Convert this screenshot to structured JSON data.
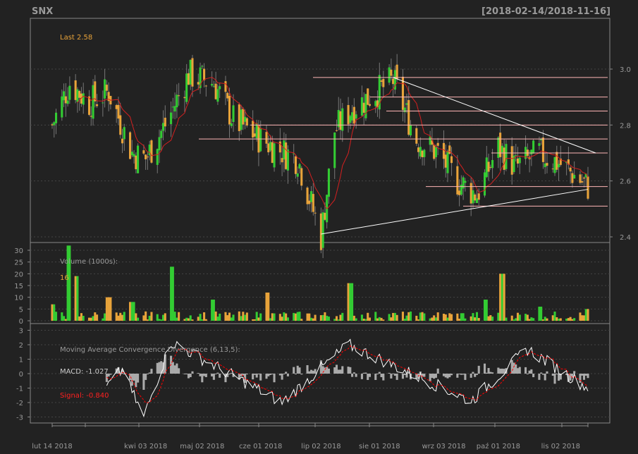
{
  "title": {
    "symbol": "SNX",
    "range": "[2018-02-14/2018-11-16]"
  },
  "colors": {
    "bg": "#222222",
    "frame": "#888888",
    "grid": "#444444",
    "up": "#33cc33",
    "down": "#e8a33a",
    "ma": "#d42020",
    "line": "#ffffff",
    "res": "#ffb6b6",
    "text": "#999999",
    "last": "#e8a33a",
    "macd": "#ffffff",
    "signal": "#ff0000",
    "hist": "#aaaaaa"
  },
  "price_panel": {
    "last_label": "Last 2.58",
    "yticks": [
      "2.4",
      "2.6",
      "2.8",
      "3.0"
    ]
  },
  "volume_panel": {
    "label": "Volume (1000s):",
    "value": "16",
    "yticks": [
      "0",
      "5",
      "10",
      "15",
      "20",
      "25",
      "30"
    ]
  },
  "macd_panel": {
    "label": "Moving Average Convergence Divergence (6,13,5):",
    "macd_text": "MACD: -1.027",
    "signal_text": "Signal: -0.840",
    "yticks": [
      "-3",
      "-2",
      "-1",
      "0",
      "1",
      "2",
      "3"
    ]
  },
  "x_labels": [
    "lut 14 2018",
    "kwi 03 2018",
    "maj 02 2018",
    "cze 01 2018",
    "lip 02 2018",
    "sie 01 2018",
    "wrz 03 2018",
    "paź 01 2018",
    "lis 02 2018"
  ],
  "chart_data": [
    {
      "type": "candlestick",
      "title": "SNX",
      "subtitle": "[2018-02-14/2018-11-16]",
      "ylim": [
        2.38,
        3.07
      ],
      "series": [
        {
          "name": "price_anchors",
          "points": [
            {
              "x": "2018-02-14",
              "y": 2.8
            },
            {
              "x": "2018-02-23",
              "y": 2.95
            },
            {
              "x": "2018-03-05",
              "y": 2.88
            },
            {
              "x": "2018-03-15",
              "y": 2.92
            },
            {
              "x": "2018-03-27",
              "y": 2.7
            },
            {
              "x": "2018-04-03",
              "y": 2.68
            },
            {
              "x": "2018-04-13",
              "y": 2.8
            },
            {
              "x": "2018-04-25",
              "y": 2.98
            },
            {
              "x": "2018-05-08",
              "y": 2.95
            },
            {
              "x": "2018-05-18",
              "y": 2.82
            },
            {
              "x": "2018-05-30",
              "y": 2.76
            },
            {
              "x": "2018-06-08",
              "y": 2.72
            },
            {
              "x": "2018-06-20",
              "y": 2.68
            },
            {
              "x": "2018-07-02",
              "y": 2.4
            },
            {
              "x": "2018-07-09",
              "y": 2.78
            },
            {
              "x": "2018-07-18",
              "y": 2.86
            },
            {
              "x": "2018-07-31",
              "y": 2.92
            },
            {
              "x": "2018-08-08",
              "y": 2.96
            },
            {
              "x": "2018-08-20",
              "y": 2.75
            },
            {
              "x": "2018-08-31",
              "y": 2.7
            },
            {
              "x": "2018-09-10",
              "y": 2.6
            },
            {
              "x": "2018-09-20",
              "y": 2.55
            },
            {
              "x": "2018-10-01",
              "y": 2.72
            },
            {
              "x": "2018-10-10",
              "y": 2.65
            },
            {
              "x": "2018-10-22",
              "y": 2.7
            },
            {
              "x": "2018-11-02",
              "y": 2.66
            },
            {
              "x": "2018-11-16",
              "y": 2.58
            }
          ]
        },
        {
          "name": "resistance_levels",
          "values": [
            2.97,
            2.9,
            2.85,
            2.8,
            2.75,
            2.7,
            2.58,
            2.51
          ]
        }
      ],
      "trendlines": [
        {
          "from": {
            "x": "2018-07-02",
            "y": 2.41
          },
          "to": {
            "x": "2018-11-16",
            "y": 2.57
          }
        },
        {
          "from": {
            "x": "2018-08-08",
            "y": 2.97
          },
          "to": {
            "x": "2018-11-20",
            "y": 2.7
          }
        }
      ]
    },
    {
      "type": "bar",
      "title": "Volume (1000s):",
      "ylim": [
        0,
        33
      ],
      "series": [
        {
          "name": "volume",
          "points": [
            {
              "x": "2018-02-14",
              "y": 7
            },
            {
              "x": "2018-02-23",
              "y": 32
            },
            {
              "x": "2018-02-26",
              "y": 19
            },
            {
              "x": "2018-03-15",
              "y": 10
            },
            {
              "x": "2018-03-27",
              "y": 8
            },
            {
              "x": "2018-04-16",
              "y": 23
            },
            {
              "x": "2018-05-07",
              "y": 9
            },
            {
              "x": "2018-06-04",
              "y": 12
            },
            {
              "x": "2018-07-17",
              "y": 16
            },
            {
              "x": "2018-09-24",
              "y": 9
            },
            {
              "x": "2018-10-03",
              "y": 20
            },
            {
              "x": "2018-10-22",
              "y": 6
            },
            {
              "x": "2018-11-16",
              "y": 5
            }
          ]
        }
      ]
    },
    {
      "type": "line",
      "title": "Moving Average Convergence Divergence (6,13,5):",
      "ylim": [
        -3.3,
        3.3
      ],
      "series": [
        {
          "name": "MACD",
          "points": [
            {
              "x": "2018-03-26",
              "y": -1.0
            },
            {
              "x": "2018-04-02",
              "y": -3.0
            },
            {
              "x": "2018-04-16",
              "y": 2.2
            },
            {
              "x": "2018-06-12",
              "y": -2.0
            },
            {
              "x": "2018-07-16",
              "y": 2.0
            },
            {
              "x": "2018-09-17",
              "y": -1.9
            },
            {
              "x": "2018-10-16",
              "y": 1.7
            },
            {
              "x": "2018-11-16",
              "y": -1.0
            }
          ]
        },
        {
          "name": "Signal",
          "points": [
            {
              "x": "2018-11-16",
              "y": -0.84
            }
          ]
        }
      ]
    }
  ]
}
